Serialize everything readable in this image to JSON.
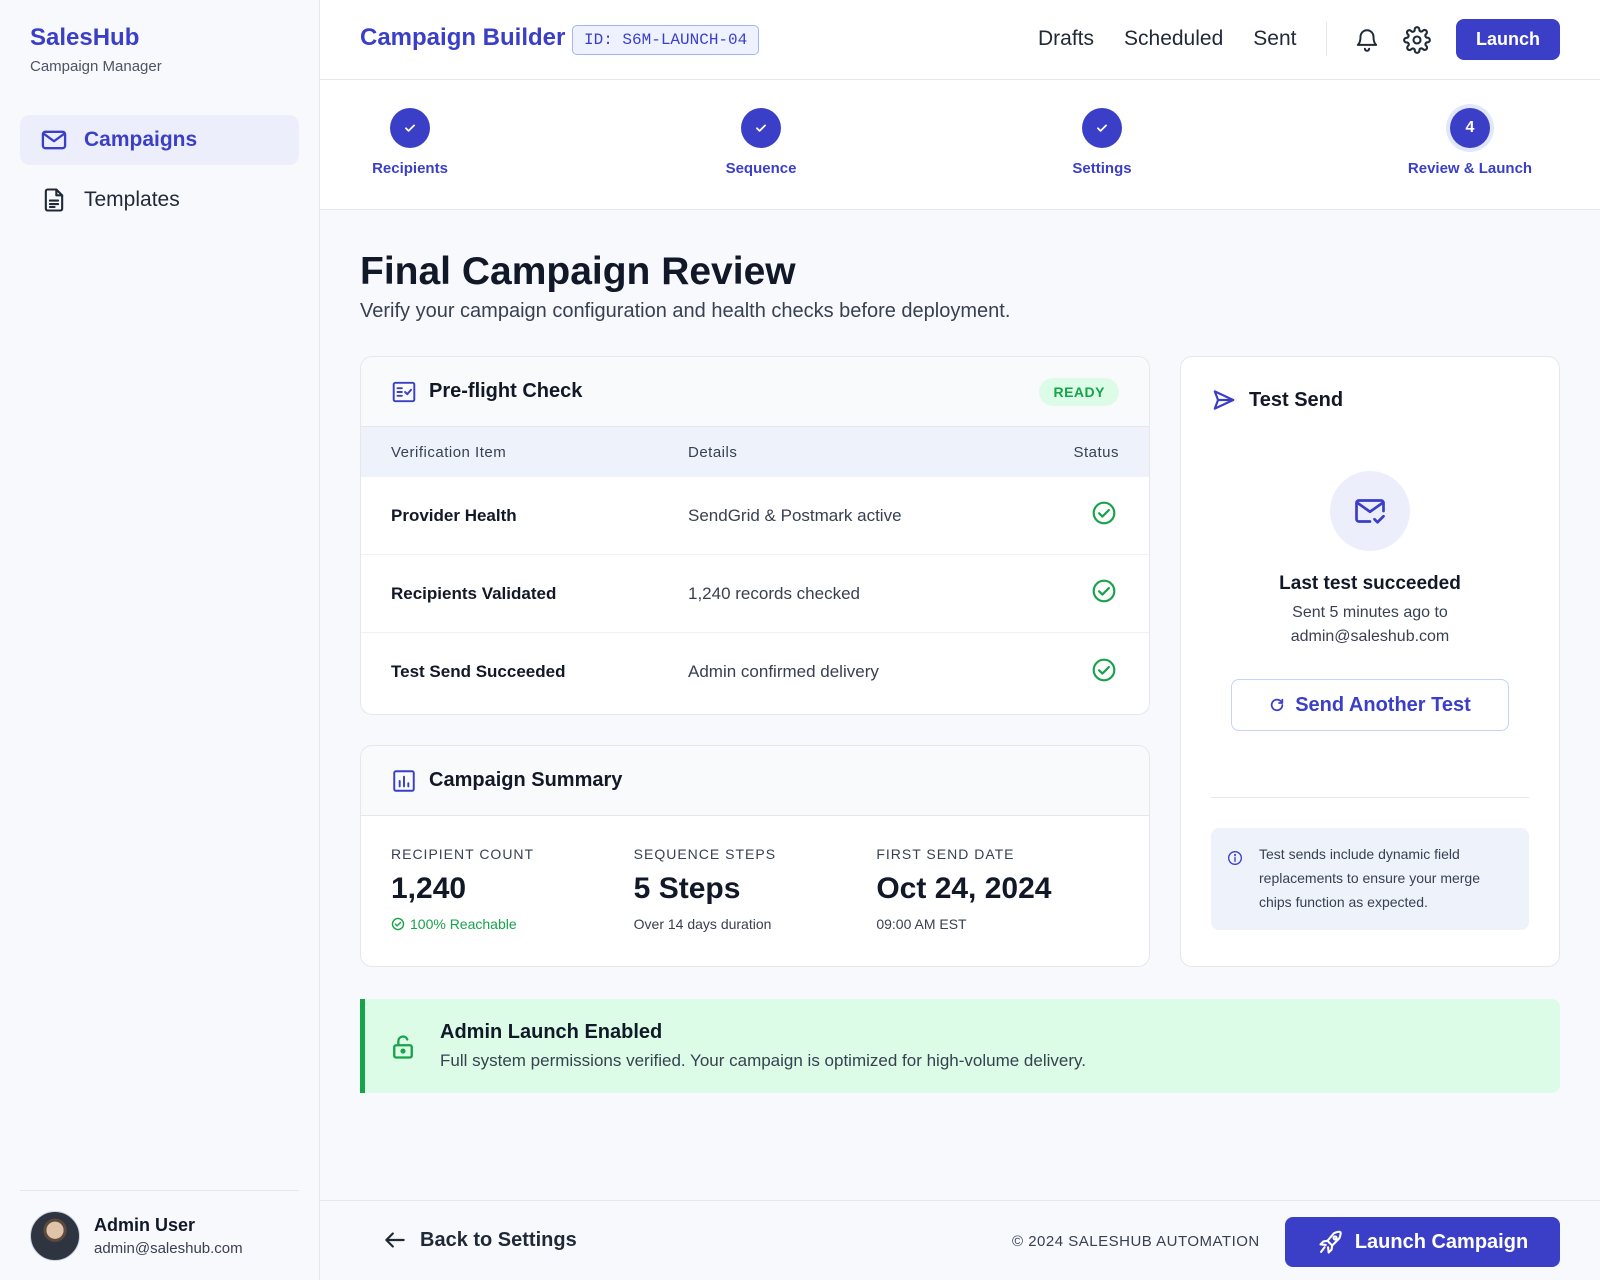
{
  "brand": {
    "name": "SalesHub",
    "subtitle": "Campaign Manager"
  },
  "sidebar": {
    "items": [
      {
        "label": "Campaigns",
        "icon": "mail-icon",
        "active": true
      },
      {
        "label": "Templates",
        "icon": "document-icon",
        "active": false
      }
    ],
    "user": {
      "name": "Admin User",
      "email": "admin@saleshub.com"
    }
  },
  "header": {
    "title": "Campaign Builder",
    "campaign_id": "ID: S6M-LAUNCH-04",
    "links": [
      "Drafts",
      "Scheduled",
      "Sent"
    ],
    "launch_label": "Launch"
  },
  "stepper": {
    "steps": [
      {
        "label": "Recipients",
        "state": "done"
      },
      {
        "label": "Sequence",
        "state": "done"
      },
      {
        "label": "Settings",
        "state": "done"
      },
      {
        "label": "Review & Launch",
        "state": "current",
        "number": "4"
      }
    ]
  },
  "page": {
    "title": "Final Campaign Review",
    "subtitle": "Verify your campaign configuration and health checks before deployment."
  },
  "preflight": {
    "title": "Pre-flight Check",
    "badge": "READY",
    "columns": [
      "Verification Item",
      "Details",
      "Status"
    ],
    "rows": [
      {
        "item": "Provider Health",
        "details": "SendGrid & Postmark active",
        "status": "ok"
      },
      {
        "item": "Recipients Validated",
        "details": "1,240 records checked",
        "status": "ok"
      },
      {
        "item": "Test Send Succeeded",
        "details": "Admin confirmed delivery",
        "status": "ok"
      }
    ]
  },
  "summary": {
    "title": "Campaign Summary",
    "metrics": [
      {
        "label": "RECIPIENT COUNT",
        "value": "1,240",
        "note": "100% Reachable"
      },
      {
        "label": "SEQUENCE STEPS",
        "value": "5 Steps",
        "note": "Over 14 days duration"
      },
      {
        "label": "FIRST SEND DATE",
        "value": "Oct 24, 2024",
        "note": "09:00 AM EST"
      }
    ]
  },
  "test_send": {
    "title": "Test Send",
    "status": "Last test succeeded",
    "detail": "Sent 5 minutes ago to admin@saleshub.com",
    "button": "Send Another Test",
    "info": "Test sends include dynamic field replacements to ensure your merge chips function as expected."
  },
  "banner": {
    "title": "Admin Launch Enabled",
    "text": "Full system permissions verified. Your campaign is optimized for high-volume delivery."
  },
  "footer": {
    "back_label": "Back to Settings",
    "copyright": "© 2024 SALESHUB AUTOMATION",
    "launch_label": "Launch Campaign"
  },
  "colors": {
    "accent": "#3b3fc7",
    "success": "#16a34a",
    "success_bg": "#dcfce7"
  }
}
